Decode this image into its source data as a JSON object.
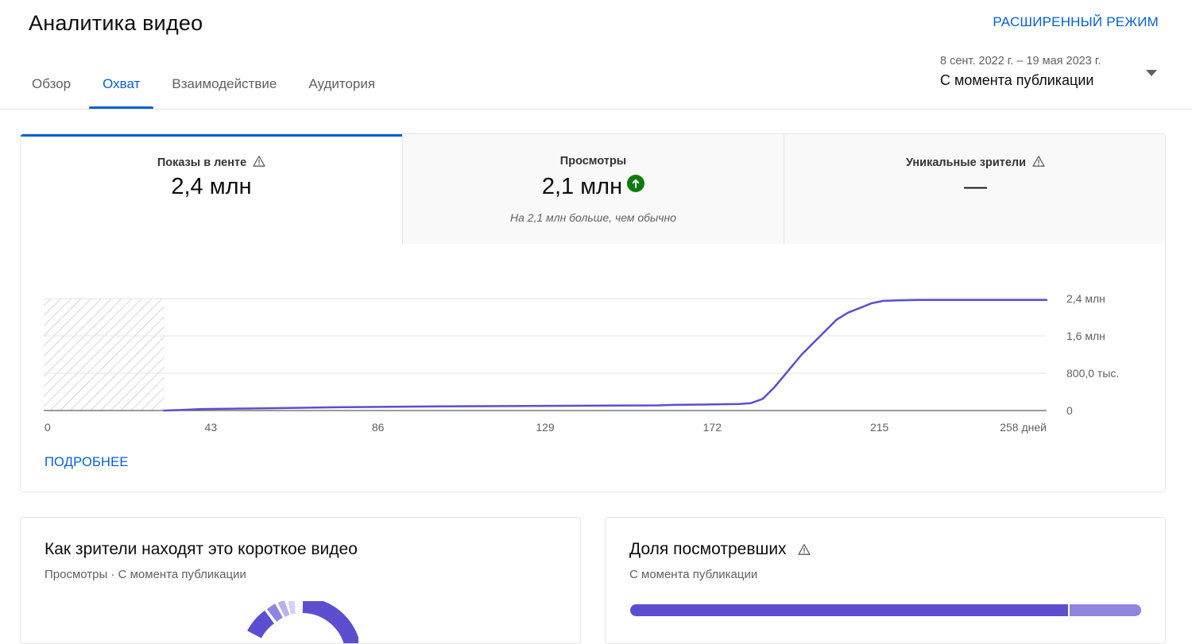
{
  "header": {
    "title": "Аналитика видео",
    "advanced_mode": "РАСШИРЕННЫЙ РЕЖИМ",
    "tabs": [
      {
        "label": "Обзор",
        "active": false
      },
      {
        "label": "Охват",
        "active": true
      },
      {
        "label": "Взаимодействие",
        "active": false
      },
      {
        "label": "Аудитория",
        "active": false
      }
    ],
    "date_range": "8 сент. 2022 г. – 19 мая 2023 г.",
    "date_mode": "С момента публикации"
  },
  "metrics": [
    {
      "label": "Показы в ленте",
      "value": "2,4 млн",
      "note": "",
      "warning": true
    },
    {
      "label": "Просмотры",
      "value": "2,1 млн",
      "note": "На 2,1 млн больше, чем обычно",
      "trend": "up"
    },
    {
      "label": "Уникальные зрители",
      "value": "—",
      "note": "",
      "warning": true
    }
  ],
  "more_link": "ПОДРОБНЕЕ",
  "chart_data": {
    "type": "line",
    "x_tick_labels": [
      "0",
      "43",
      "86",
      "129",
      "172",
      "215",
      "258 дней"
    ],
    "x_ticks": [
      0,
      43,
      86,
      129,
      172,
      215,
      258
    ],
    "y_tick_labels": [
      "0",
      "800,0 тыс.",
      "1,6 млн",
      "2,4 млн"
    ],
    "y_ticks": [
      0,
      800000,
      1600000,
      2400000
    ],
    "xlim": [
      0,
      258
    ],
    "ylim": [
      0,
      2400000
    ],
    "grid": true,
    "no_data_range": [
      0,
      31
    ],
    "series": [
      {
        "color": "#5b4fcf",
        "x": [
          31,
          35,
          40,
          58,
          75,
          102,
          158,
          162,
          179,
          182,
          185,
          188,
          192,
          195,
          198,
          201,
          204,
          207,
          210,
          213,
          216,
          220,
          225,
          240,
          258
        ],
        "y": [
          0,
          10000,
          30000,
          50000,
          70000,
          90000,
          110000,
          120000,
          140000,
          160000,
          250000,
          500000,
          900000,
          1200000,
          1450000,
          1700000,
          1950000,
          2100000,
          2200000,
          2300000,
          2350000,
          2360000,
          2370000,
          2370000,
          2370000
        ]
      }
    ]
  },
  "sources_card": {
    "title": "Как зрители находят это короткое видео",
    "subtitle": "Просмотры · С момента публикации"
  },
  "retention_card": {
    "title": "Доля посмотревших",
    "subtitle": "С момента публикации",
    "bar_segments": [
      {
        "fraction": 0.86,
        "color": "#5b4fcf"
      },
      {
        "fraction": 0.14,
        "color": "#8f85e0"
      }
    ]
  }
}
